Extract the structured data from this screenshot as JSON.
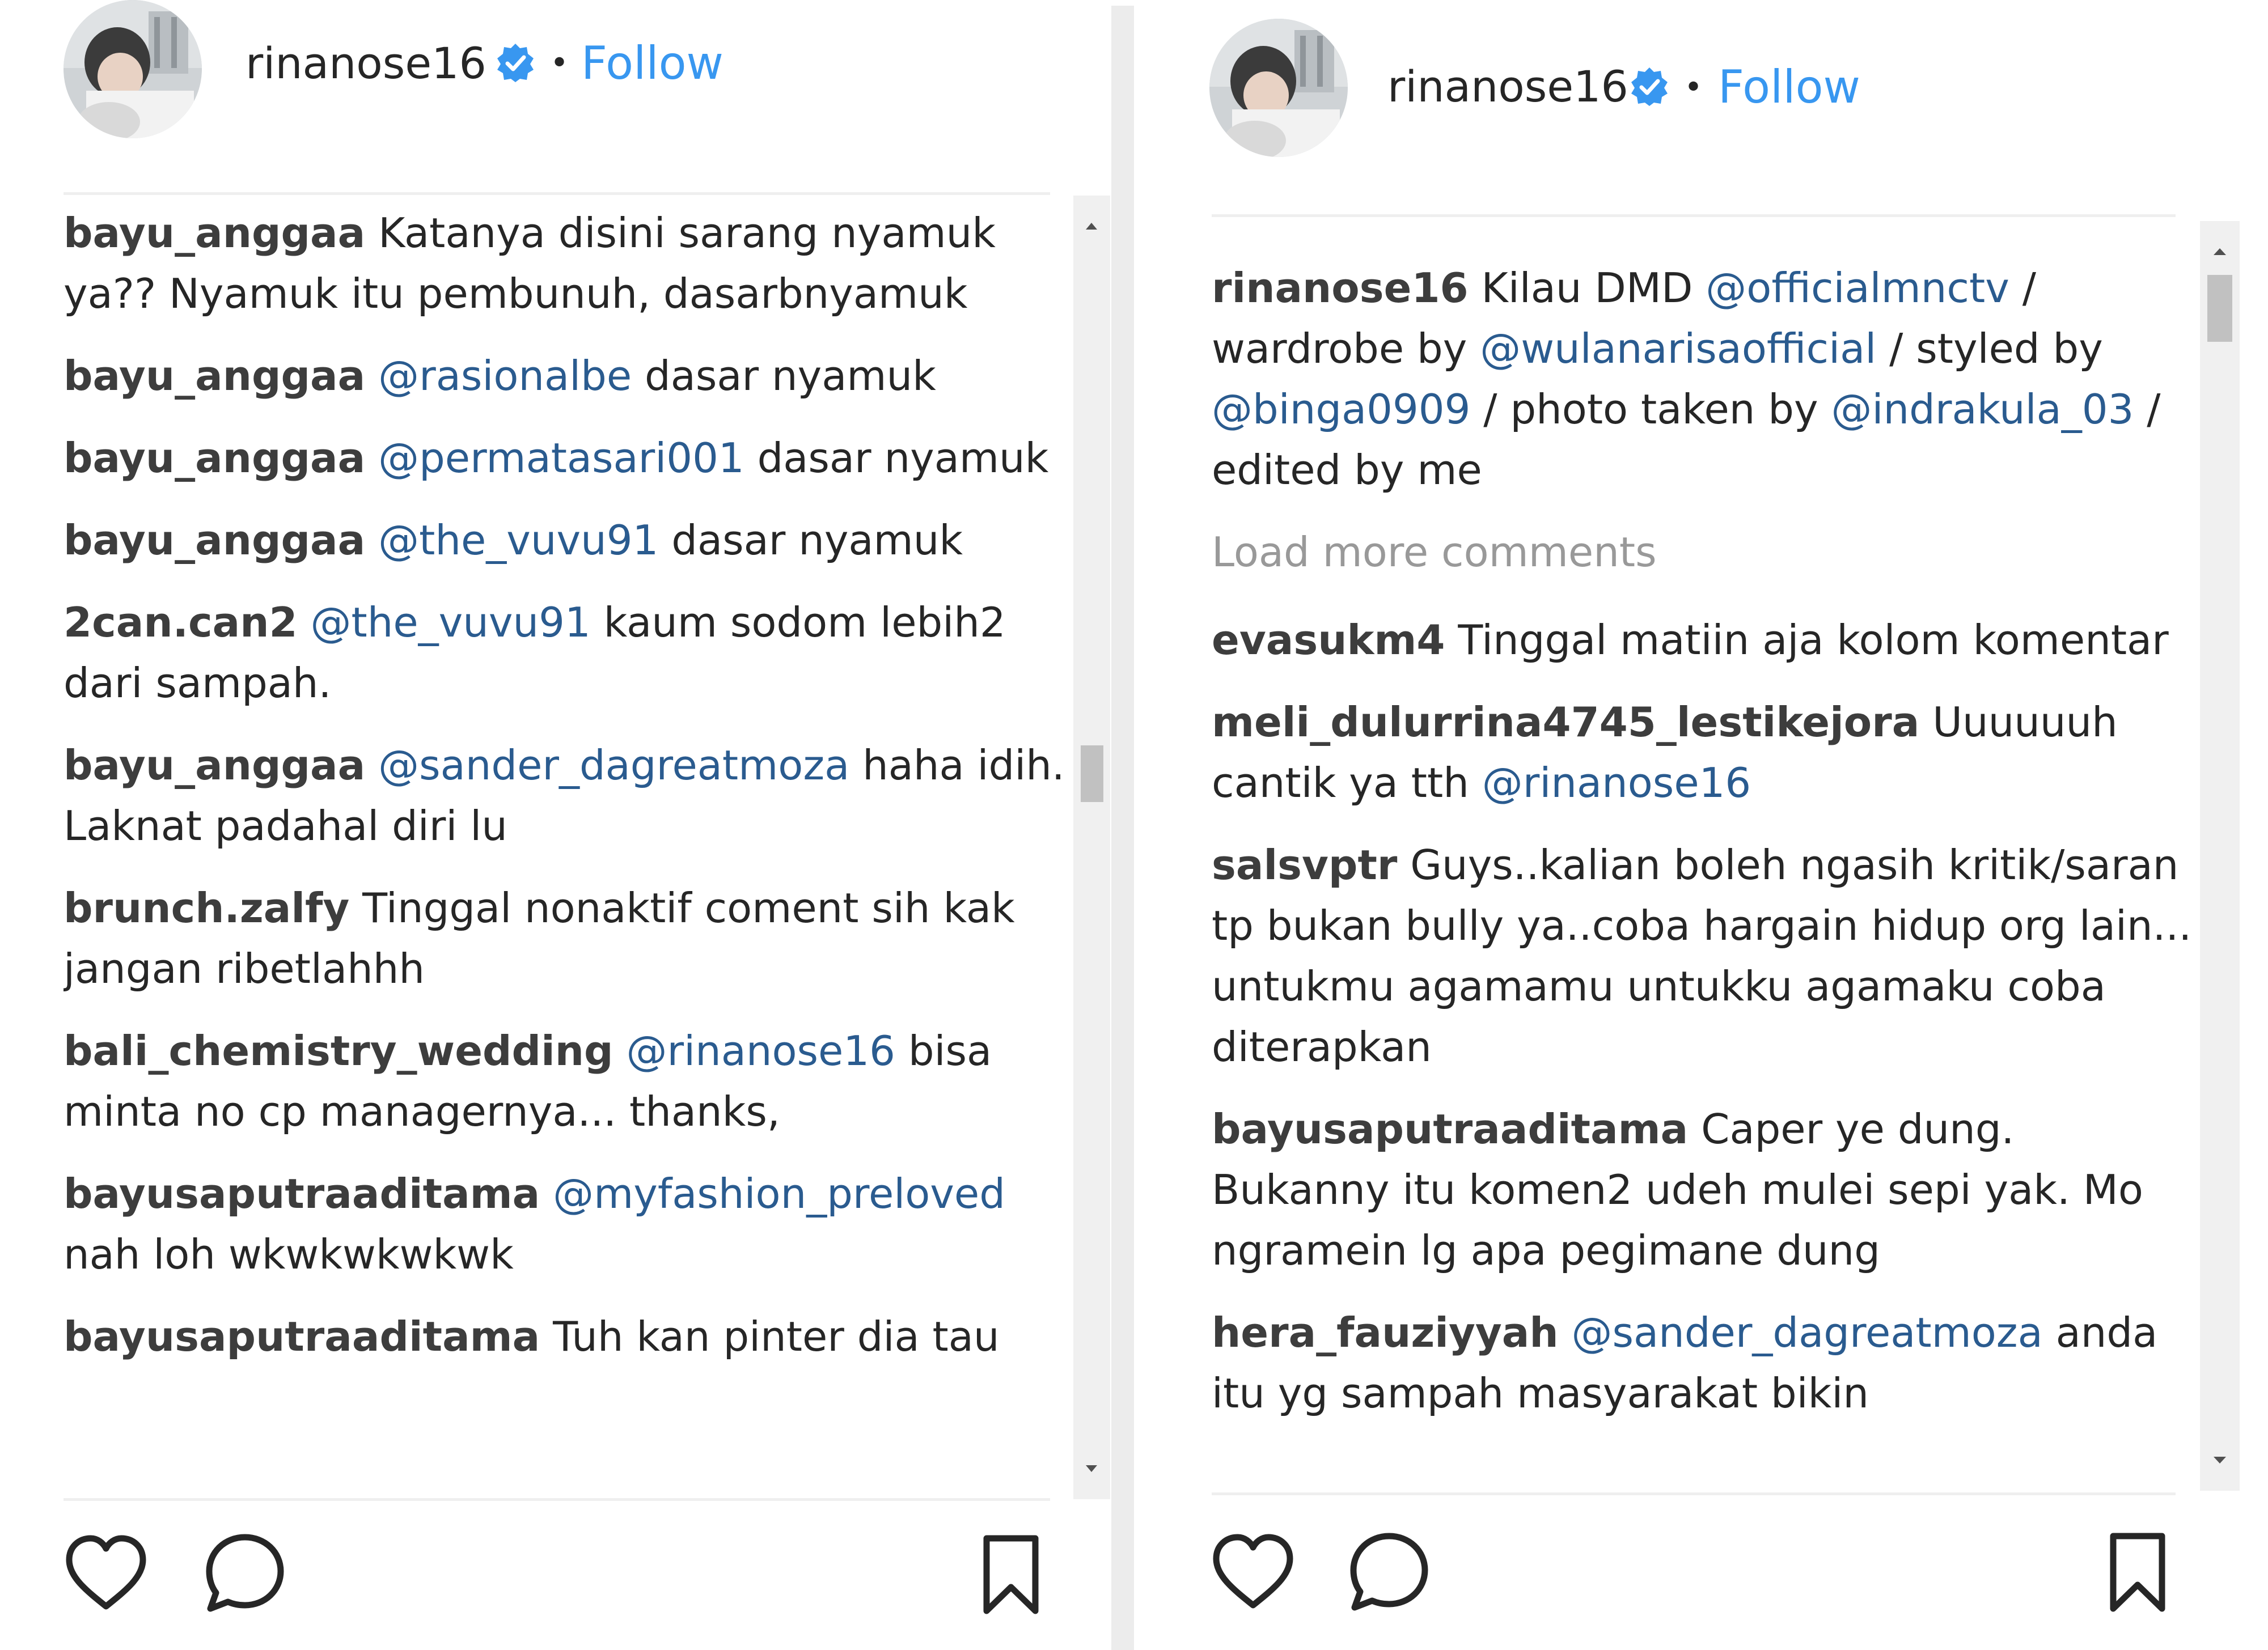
{
  "left": {
    "header": {
      "username": "rinanose16",
      "separator": "•",
      "follow_label": "Follow",
      "avatar_icon": "profile-photo"
    },
    "comments": [
      {
        "user": "bayu_anggaa",
        "parts": [
          {
            "t": "text",
            "v": " Katanya disini sarang nyamuk ya?? Nyamuk itu pembunuh, dasarbnyamuk"
          }
        ]
      },
      {
        "user": "bayu_anggaa",
        "parts": [
          {
            "t": "text",
            "v": " "
          },
          {
            "t": "mention",
            "v": "@rasionalbe"
          },
          {
            "t": "text",
            "v": " dasar nyamuk"
          }
        ]
      },
      {
        "user": "bayu_anggaa",
        "parts": [
          {
            "t": "text",
            "v": " "
          },
          {
            "t": "mention",
            "v": "@permatasari001"
          },
          {
            "t": "text",
            "v": " dasar nyamuk"
          }
        ]
      },
      {
        "user": "bayu_anggaa",
        "parts": [
          {
            "t": "text",
            "v": " "
          },
          {
            "t": "mention",
            "v": "@the_vuvu91"
          },
          {
            "t": "text",
            "v": " dasar nyamuk"
          }
        ]
      },
      {
        "user": "2can.can2",
        "parts": [
          {
            "t": "text",
            "v": " "
          },
          {
            "t": "mention",
            "v": "@the_vuvu91"
          },
          {
            "t": "text",
            "v": " kaum sodom lebih2 dari sampah."
          }
        ]
      },
      {
        "user": "bayu_anggaa",
        "parts": [
          {
            "t": "text",
            "v": " "
          },
          {
            "t": "mention",
            "v": "@sander_dagreatmoza"
          },
          {
            "t": "text",
            "v": " haha idih. Laknat padahal diri lu"
          }
        ]
      },
      {
        "user": "brunch.zalfy",
        "parts": [
          {
            "t": "text",
            "v": " Tinggal nonaktif coment sih kak jangan ribetlahhh"
          }
        ]
      },
      {
        "user": "bali_chemistry_wedding",
        "parts": [
          {
            "t": "text",
            "v": " "
          },
          {
            "t": "mention",
            "v": "@rinanose16"
          },
          {
            "t": "text",
            "v": " bisa minta no cp managernya... thanks,"
          }
        ]
      },
      {
        "user": "bayusaputraaditama",
        "parts": [
          {
            "t": "text",
            "v": " "
          },
          {
            "t": "mention",
            "v": "@myfashion_preloved"
          },
          {
            "t": "text",
            "v": " nah loh wkwkwkwkwk"
          }
        ]
      },
      {
        "user": "bayusaputraaditama",
        "parts": [
          {
            "t": "text",
            "v": " Tuh kan pinter dia tau"
          }
        ]
      }
    ],
    "icons": {
      "like": "heart-icon",
      "comment": "comment-icon",
      "save": "bookmark-icon"
    }
  },
  "right": {
    "header": {
      "username": "rinanose16",
      "separator": "•",
      "follow_label": "Follow",
      "avatar_icon": "profile-photo"
    },
    "caption": {
      "user": "rinanose16",
      "parts": [
        {
          "t": "text",
          "v": " Kilau DMD "
        },
        {
          "t": "mention",
          "v": "@officialmnctv"
        },
        {
          "t": "text",
          "v": " / wardrobe by "
        },
        {
          "t": "mention",
          "v": "@wulanarisaofficial"
        },
        {
          "t": "text",
          "v": " / styled by "
        },
        {
          "t": "mention",
          "v": "@binga0909"
        },
        {
          "t": "text",
          "v": " / photo taken by "
        },
        {
          "t": "mention",
          "v": "@indrakula_03"
        },
        {
          "t": "text",
          "v": " / edited by me"
        }
      ]
    },
    "load_more_label": "Load more comments",
    "comments": [
      {
        "user": "evasukm4",
        "parts": [
          {
            "t": "text",
            "v": " Tinggal matiin aja kolom komentar"
          }
        ]
      },
      {
        "user": "meli_dulurrina4745_lestikejora",
        "parts": [
          {
            "t": "text",
            "v": " Uuuuuuh cantik ya tth "
          },
          {
            "t": "mention",
            "v": "@rinanose16"
          }
        ]
      },
      {
        "user": "salsvptr",
        "parts": [
          {
            "t": "text",
            "v": " Guys..kalian boleh ngasih kritik/saran tp bukan bully ya..coba hargain hidup org lain... untukmu agamamu untukku agamaku coba diterapkan"
          }
        ]
      },
      {
        "user": "bayusaputraaditama",
        "parts": [
          {
            "t": "text",
            "v": " Caper ye dung. Bukanny itu komen2 udeh mulei sepi yak. Mo ngramein lg apa pegimane dung"
          }
        ]
      },
      {
        "user": "hera_fauziyyah",
        "parts": [
          {
            "t": "text",
            "v": " "
          },
          {
            "t": "mention",
            "v": "@sander_dagreatmoza"
          },
          {
            "t": "text",
            "v": " anda itu yg sampah masyarakat bikin"
          }
        ]
      }
    ],
    "icons": {
      "like": "heart-icon",
      "comment": "comment-icon",
      "save": "bookmark-icon"
    }
  },
  "colors": {
    "follow": "#3897f0",
    "mention": "#2a5b8f",
    "verified": "#3897f0",
    "muted": "#999999"
  }
}
